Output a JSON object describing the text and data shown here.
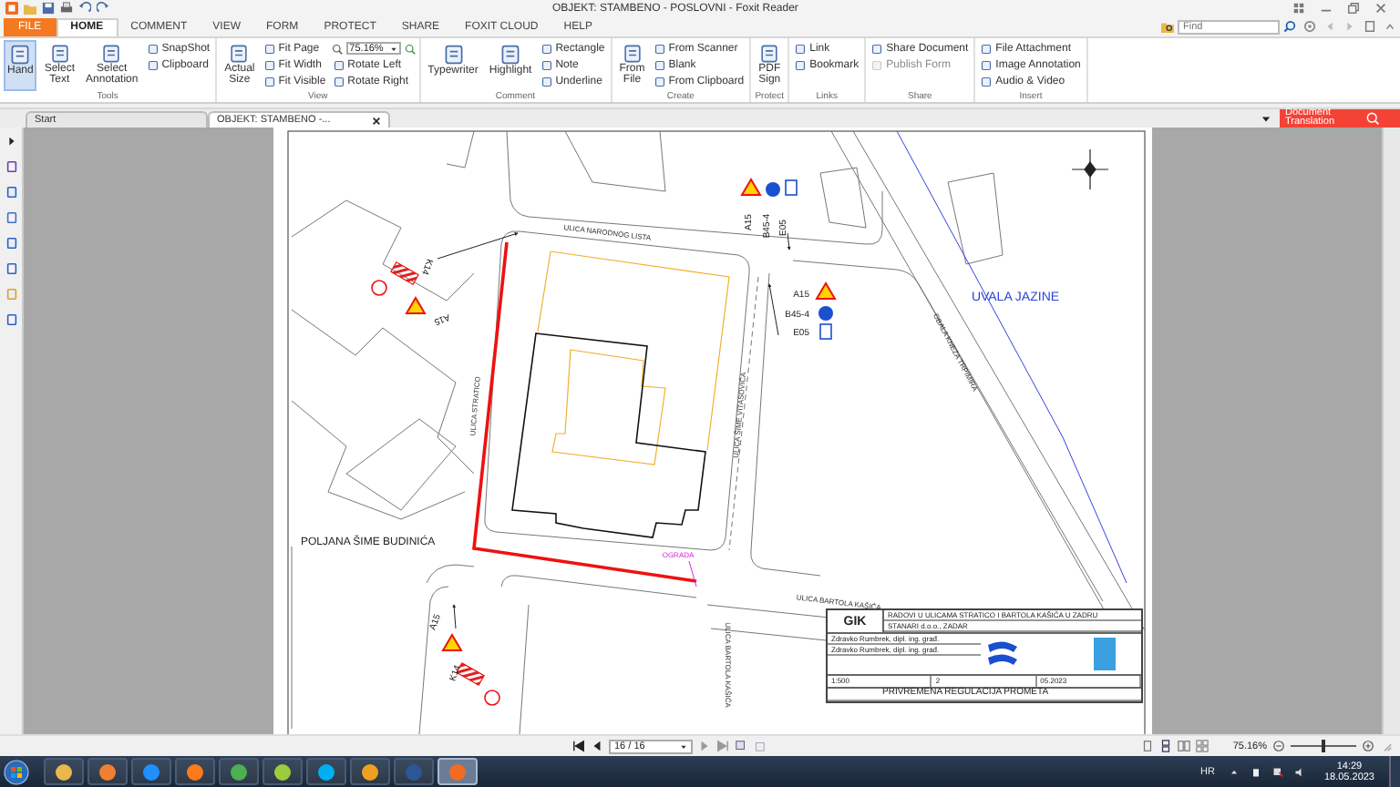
{
  "window": {
    "title": "OBJEKT: STAMBENO - POSLOVNI - Foxit Reader"
  },
  "menu_tabs": [
    {
      "label": "FILE",
      "kind": "file",
      "selected": false
    },
    {
      "label": "HOME",
      "kind": "tab",
      "selected": true
    },
    {
      "label": "COMMENT",
      "kind": "tab",
      "selected": false
    },
    {
      "label": "VIEW",
      "kind": "tab",
      "selected": false
    },
    {
      "label": "FORM",
      "kind": "tab",
      "selected": false
    },
    {
      "label": "PROTECT",
      "kind": "tab",
      "selected": false
    },
    {
      "label": "SHARE",
      "kind": "tab",
      "selected": false
    },
    {
      "label": "FOXIT CLOUD",
      "kind": "tab",
      "selected": false
    },
    {
      "label": "HELP",
      "kind": "tab",
      "selected": false
    }
  ],
  "find": {
    "placeholder": "Find"
  },
  "ribbon": [
    {
      "label": "Tools",
      "items": [
        {
          "kind": "large",
          "label": "Hand",
          "selected": true
        },
        {
          "kind": "large",
          "label": "Select Text",
          "selected": false
        },
        {
          "kind": "large",
          "label": "Select Annotation",
          "selected": false
        },
        {
          "kind": "stack",
          "entries": [
            {
              "kind": "small",
              "label": "SnapShot",
              "disabled": false
            },
            {
              "kind": "small",
              "label": "Clipboard",
              "disabled": false
            }
          ]
        }
      ]
    },
    {
      "label": "View",
      "items": [
        {
          "kind": "large",
          "label": "Actual Size",
          "selected": false
        },
        {
          "kind": "stack",
          "entries": [
            {
              "kind": "small",
              "label": "Fit Page",
              "disabled": false
            },
            {
              "kind": "small",
              "label": "Fit Width",
              "disabled": false
            },
            {
              "kind": "small",
              "label": "Fit Visible",
              "disabled": false
            }
          ]
        },
        {
          "kind": "stack",
          "entries": [
            {
              "kind": "combo",
              "label": "75.16%",
              "disabled": false
            },
            {
              "kind": "small",
              "label": "Rotate Left",
              "disabled": false
            },
            {
              "kind": "small",
              "label": "Rotate Right",
              "disabled": false
            }
          ]
        }
      ]
    },
    {
      "label": "Comment",
      "items": [
        {
          "kind": "large",
          "label": "Typewriter",
          "selected": false
        },
        {
          "kind": "large",
          "label": "Highlight",
          "selected": false
        },
        {
          "kind": "stack",
          "entries": [
            {
              "kind": "small",
              "label": "Rectangle",
              "disabled": false
            },
            {
              "kind": "small",
              "label": "Note",
              "disabled": false
            },
            {
              "kind": "small",
              "label": "Underline",
              "disabled": false
            }
          ]
        }
      ]
    },
    {
      "label": "Create",
      "items": [
        {
          "kind": "large",
          "label": "From File",
          "selected": false
        },
        {
          "kind": "stack",
          "entries": [
            {
              "kind": "small",
              "label": "From Scanner",
              "disabled": false
            },
            {
              "kind": "small",
              "label": "Blank",
              "disabled": false
            },
            {
              "kind": "small",
              "label": "From Clipboard",
              "disabled": false
            }
          ]
        }
      ]
    },
    {
      "label": "Protect",
      "items": [
        {
          "kind": "large",
          "label": "PDF Sign",
          "selected": false
        }
      ]
    },
    {
      "label": "Links",
      "items": [
        {
          "kind": "stack",
          "entries": [
            {
              "kind": "small",
              "label": "Link",
              "disabled": false
            },
            {
              "kind": "small",
              "label": "Bookmark",
              "disabled": false
            }
          ]
        }
      ]
    },
    {
      "label": "Share",
      "items": [
        {
          "kind": "stack",
          "entries": [
            {
              "kind": "small",
              "label": "Share Document",
              "disabled": false
            },
            {
              "kind": "small",
              "label": "Publish Form",
              "disabled": true
            }
          ]
        }
      ]
    },
    {
      "label": "Insert",
      "items": [
        {
          "kind": "stack",
          "entries": [
            {
              "kind": "small",
              "label": "File Attachment",
              "disabled": false
            },
            {
              "kind": "small",
              "label": "Image Annotation",
              "disabled": false
            },
            {
              "kind": "small",
              "label": "Audio & Video",
              "disabled": false
            }
          ]
        }
      ]
    }
  ],
  "doc_tabs": [
    {
      "label": "Start",
      "selected": false,
      "closable": false
    },
    {
      "label": "OBJEKT: STAMBENO -...",
      "selected": true,
      "closable": true
    }
  ],
  "translate_button": "Document Translation",
  "drawing": {
    "street_labels": [
      "ULICA NARODNOG LISTA",
      "ULICA STRATICO",
      "ULICA ŠIME VITASOVIĆA",
      "OBALA KNEZA TRPIMIRA",
      "ULICA BARTOLA KAŠIĆA",
      "ULICA BARTOLA KAŠIĆA"
    ],
    "place_labels": [
      "UVALA JAZINE",
      "POLJANA ŠIME BUDINIĆA"
    ],
    "fence_label": "OGRADA",
    "sign_groups": [
      {
        "signs": [
          {
            "kind": "triangle"
          },
          {
            "kind": "round"
          },
          {
            "kind": "plate"
          }
        ],
        "codes": [
          "A15",
          "B45-4",
          "E05"
        ]
      },
      {
        "signs": [
          {
            "kind": "triangle"
          },
          {
            "kind": "round"
          },
          {
            "kind": "plate"
          }
        ],
        "codes": [
          "A15",
          "B45-4",
          "E05"
        ]
      },
      {
        "signs": [
          {
            "kind": "barrier"
          },
          {
            "kind": "ring"
          },
          {
            "kind": "triangle"
          }
        ],
        "codes": [
          "K14",
          "A15"
        ]
      },
      {
        "signs": [
          {
            "kind": "triangle"
          },
          {
            "kind": "barrier"
          },
          {
            "kind": "ring"
          }
        ],
        "codes": [
          "A15",
          "K14"
        ]
      }
    ],
    "title_block": {
      "logo": "GIK",
      "project": "RADOVI U ULICAMA STRATICO I BARTOLA KAŠIĆA U ZADRU",
      "investor": "STANARI d.o.o., ZADAR",
      "designers": [
        "Zdravko Rumbrek, dipl. ing. građ.",
        "Zdravko Rumbrek, dipl. ing. građ."
      ],
      "scale": "1:500",
      "sheet": "2",
      "date": "05.2023",
      "drawing_title": "PRIVREMENA REGULACIJA PROMETA"
    }
  },
  "status_bar": {
    "page": "16 / 16",
    "zoom": "75.16%",
    "zoom_slider": {
      "level": 0.5
    }
  },
  "taskbar": {
    "apps": [
      {
        "color": "#e8b84a",
        "selected": false
      },
      {
        "color": "#f08030",
        "selected": false
      },
      {
        "color": "#1e90ff",
        "selected": false
      },
      {
        "color": "#ff7a1a",
        "selected": false
      },
      {
        "color": "#4caf50",
        "selected": false
      },
      {
        "color": "#9ccc3c",
        "selected": false
      },
      {
        "color": "#00aff0",
        "selected": false
      },
      {
        "color": "#f0a020",
        "selected": false
      },
      {
        "color": "#2b5797",
        "selected": false
      },
      {
        "color": "#f26b21",
        "selected": true
      }
    ],
    "language": "HR",
    "time": "14:29",
    "date": "18.05.2023"
  }
}
